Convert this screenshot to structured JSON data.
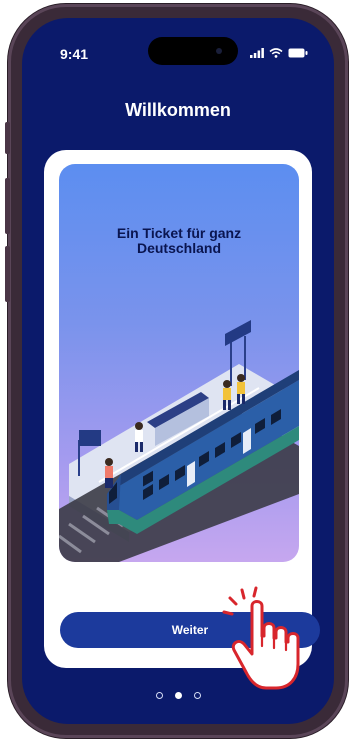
{
  "status_bar": {
    "time": "9:41"
  },
  "header": {
    "title": "Willkommen"
  },
  "onboarding": {
    "headline": "Ein Ticket für ganz Deutschland",
    "cta_label": "Weiter",
    "pages": [
      {
        "active": false
      },
      {
        "active": true
      },
      {
        "active": false
      }
    ]
  },
  "icons": {
    "signal": "signal-icon",
    "wifi": "wifi-icon",
    "battery": "battery-icon",
    "hand": "hand-pointer-icon"
  },
  "colors": {
    "background": "#0b1a6b",
    "button": "#1c3a9c",
    "card": "#ffffff",
    "hand_outline": "#d8262c"
  }
}
